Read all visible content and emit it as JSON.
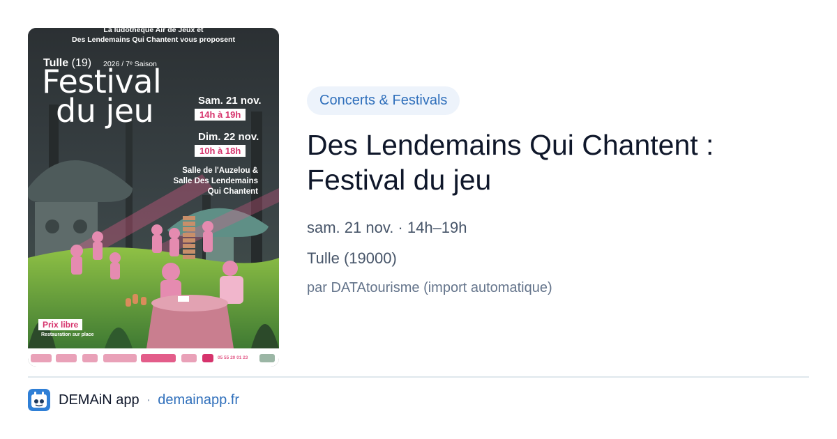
{
  "poster": {
    "top_line_1": "La ludothèque Air de Jeux et",
    "top_line_2": "Des Lendemains Qui Chantent vous proposent",
    "city": "Tulle",
    "department": "(19)",
    "season": "2026 / 7ᵉ Saison",
    "title_line_1": "Festival",
    "title_line_2": "du jeu",
    "day1_date": "Sam. 21 nov.",
    "day1_hours": "14h à 19h",
    "day2_date": "Dim. 22 nov.",
    "day2_hours": "10h à 18h",
    "venue_line_1": "Salle de l'Auzelou &",
    "venue_line_2": "Salle Des Lendemains",
    "venue_line_3": "Qui Chantent",
    "price": "Prix libre",
    "catering": "Restauration sur place",
    "phone": "05 55 20 01 23",
    "accent_color": "#d6336c",
    "background_color": "#2f3436"
  },
  "event": {
    "category": "Concerts & Festivals",
    "title_line_1": "Des Lendemains Qui Chantent :",
    "title_line_2": "Festival du jeu",
    "datetime": "sam. 21 nov. · 14h–19h",
    "location": "Tulle (19000)",
    "source": "par DATAtourisme (import automatique)"
  },
  "footer": {
    "app_icon": "demain-app-icon",
    "app_name": "DEMAiN app",
    "separator": "·",
    "domain": "demainapp.fr"
  },
  "colors": {
    "pill_background": "#edf3fb",
    "pill_text": "#2f6fbb",
    "title": "#0f172a",
    "meta_text": "#475569",
    "link": "#2f6fbb"
  }
}
